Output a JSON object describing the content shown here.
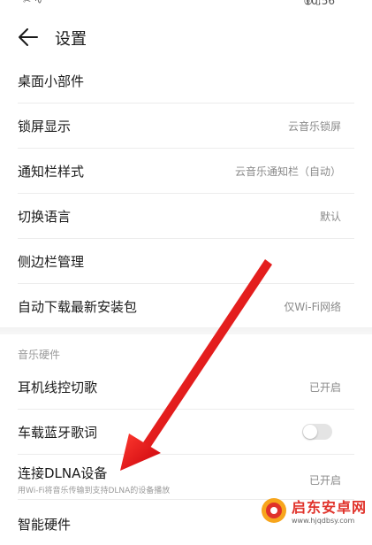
{
  "status_bar": {
    "left_glyphs": "✂ ∿",
    "right_glyphs": "◎ ▯",
    "time": "10:56"
  },
  "header": {
    "title": "设置"
  },
  "settings": [
    {
      "label": "桌面小部件",
      "value": ""
    },
    {
      "label": "锁屏显示",
      "value": "云音乐锁屏"
    },
    {
      "label": "通知栏样式",
      "value": "云音乐通知栏（自动）"
    },
    {
      "label": "切换语言",
      "value": "默认"
    },
    {
      "label": "侧边栏管理",
      "value": ""
    },
    {
      "label": "自动下载最新安装包",
      "value": "仅Wi-Fi网络"
    }
  ],
  "music_hardware": {
    "section_label": "音乐硬件",
    "items": [
      {
        "label": "耳机线控切歌",
        "value": "已开启"
      },
      {
        "label": "车载蓝牙歌词",
        "toggle": false
      },
      {
        "label": "连接DLNA设备",
        "subtitle": "用Wi-Fi将音乐传输到支持DLNA的设备播放",
        "value": "已开启"
      },
      {
        "label": "智能硬件"
      }
    ]
  },
  "watermark": {
    "text_cn": "启东安卓网",
    "text_en": "www.hjqdbsy.com"
  },
  "colors": {
    "arrow": "#e3141b",
    "watermark": "#e0322a"
  },
  "icons": [
    "back-arrow-icon",
    "signal-icon",
    "alarm-icon",
    "battery-icon",
    "site-logo-icon"
  ]
}
